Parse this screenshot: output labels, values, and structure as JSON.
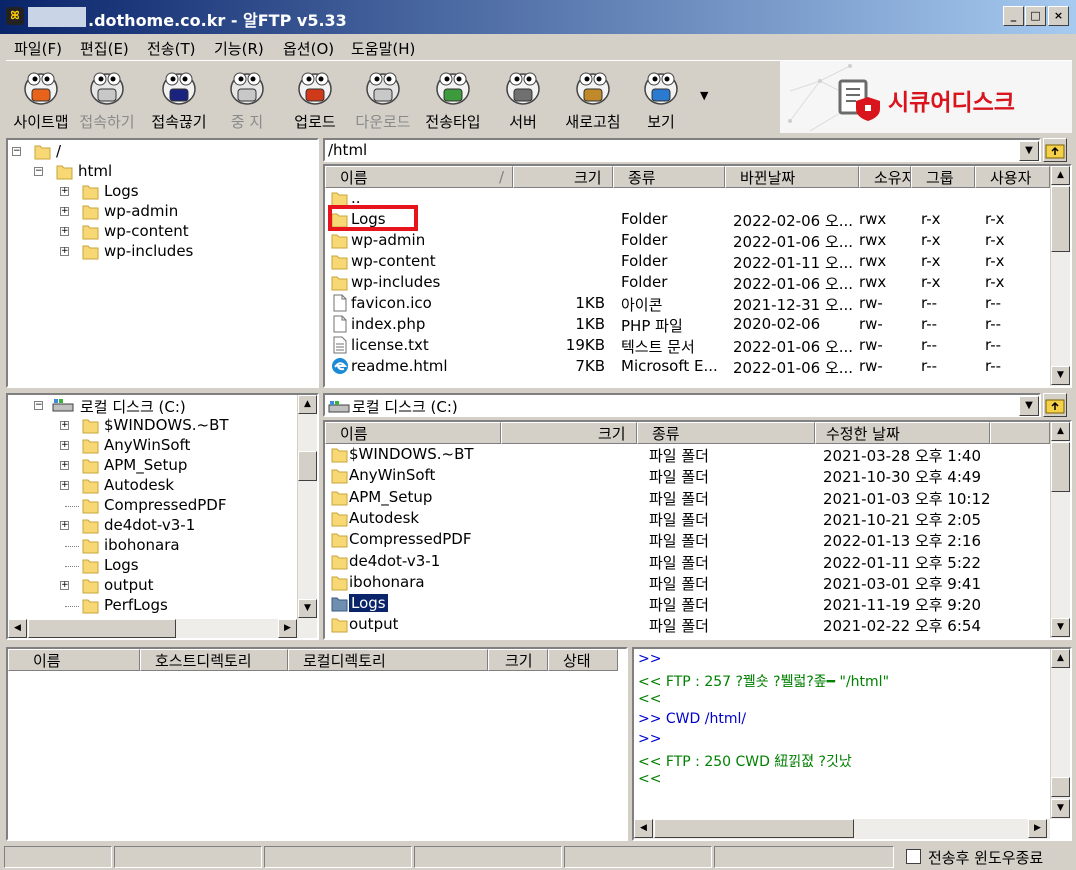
{
  "window": {
    "title": ".dothome.co.kr - 알FTP v5.33",
    "minimize_glyph": "_",
    "maximize_glyph": "□",
    "close_glyph": "×"
  },
  "menu": [
    "파일(F)",
    "편집(E)",
    "전송(T)",
    "기능(R)",
    "옵션(O)",
    "도움말(H)"
  ],
  "toolbar": [
    {
      "label": "사이트맵",
      "icon": "sitemap-icon",
      "enabled": true
    },
    {
      "label": "접속하기",
      "icon": "connect-icon",
      "enabled": false
    },
    {
      "label": "접속끊기",
      "icon": "disconnect-icon",
      "enabled": true
    },
    {
      "label": "중 지",
      "icon": "stop-icon",
      "enabled": false
    },
    {
      "label": "업로드",
      "icon": "upload-icon",
      "enabled": true
    },
    {
      "label": "다운로드",
      "icon": "download-icon",
      "enabled": false
    },
    {
      "label": "전송타입",
      "icon": "transfer-type-icon",
      "enabled": true
    },
    {
      "label": "서버",
      "icon": "server-icon",
      "enabled": true
    },
    {
      "label": "새로고침",
      "icon": "refresh-icon",
      "enabled": true
    },
    {
      "label": "보기",
      "icon": "view-icon",
      "enabled": true
    }
  ],
  "brand": {
    "text": "시큐어디스크",
    "color": "#d9141d"
  },
  "remote_tree": [
    {
      "label": "/",
      "level": 0,
      "expander": "−"
    },
    {
      "label": "html",
      "level": 1,
      "expander": "−"
    },
    {
      "label": "Logs",
      "level": 2,
      "expander": "+"
    },
    {
      "label": "wp-admin",
      "level": 2,
      "expander": "+"
    },
    {
      "label": "wp-content",
      "level": 2,
      "expander": "+"
    },
    {
      "label": "wp-includes",
      "level": 2,
      "expander": "+"
    }
  ],
  "remote_path": "/html",
  "remote_columns": [
    "이름",
    "크기",
    "종류",
    "바뀐날짜",
    "소유자",
    "그룹",
    "사용자"
  ],
  "remote_files": [
    {
      "name": "..",
      "size": "",
      "type": "",
      "date": "",
      "owner": "",
      "group": "",
      "other": "",
      "icon": "folder"
    },
    {
      "name": "Logs",
      "size": "",
      "type": "Folder",
      "date": "2022-02-06 오...",
      "owner": "rwx",
      "group": "r-x",
      "other": "r-x",
      "icon": "folder"
    },
    {
      "name": "wp-admin",
      "size": "",
      "type": "Folder",
      "date": "2022-01-06 오...",
      "owner": "rwx",
      "group": "r-x",
      "other": "r-x",
      "icon": "folder"
    },
    {
      "name": "wp-content",
      "size": "",
      "type": "Folder",
      "date": "2022-01-11 오...",
      "owner": "rwx",
      "group": "r-x",
      "other": "r-x",
      "icon": "folder"
    },
    {
      "name": "wp-includes",
      "size": "",
      "type": "Folder",
      "date": "2022-01-06 오...",
      "owner": "rwx",
      "group": "r-x",
      "other": "r-x",
      "icon": "folder"
    },
    {
      "name": "favicon.ico",
      "size": "1KB",
      "type": "아이콘",
      "date": "2021-12-31 오...",
      "owner": "rw-",
      "group": "r--",
      "other": "r--",
      "icon": "file"
    },
    {
      "name": "index.php",
      "size": "1KB",
      "type": "PHP 파일",
      "date": "2020-02-06",
      "owner": "rw-",
      "group": "r--",
      "other": "r--",
      "icon": "file"
    },
    {
      "name": "license.txt",
      "size": "19KB",
      "type": "텍스트 문서",
      "date": "2022-01-06 오...",
      "owner": "rw-",
      "group": "r--",
      "other": "r--",
      "icon": "text"
    },
    {
      "name": "readme.html",
      "size": "7KB",
      "type": "Microsoft E...",
      "date": "2022-01-06 오...",
      "owner": "rw-",
      "group": "r--",
      "other": "r--",
      "icon": "edge"
    }
  ],
  "local_tree": [
    {
      "label": "로컬 디스크 (C:)",
      "level": 0,
      "expander": "−"
    },
    {
      "label": "$WINDOWS.~BT",
      "level": 1,
      "expander": "+"
    },
    {
      "label": "AnyWinSoft",
      "level": 1,
      "expander": "+"
    },
    {
      "label": "APM_Setup",
      "level": 1,
      "expander": "+"
    },
    {
      "label": "Autodesk",
      "level": 1,
      "expander": "+"
    },
    {
      "label": "CompressedPDF",
      "level": 1,
      "expander": ""
    },
    {
      "label": "de4dot-v3-1",
      "level": 1,
      "expander": "+"
    },
    {
      "label": "ibohonara",
      "level": 1,
      "expander": ""
    },
    {
      "label": "Logs",
      "level": 1,
      "expander": ""
    },
    {
      "label": "output",
      "level": 1,
      "expander": "+"
    },
    {
      "label": "PerfLogs",
      "level": 1,
      "expander": ""
    }
  ],
  "local_path": "로컬 디스크 (C:)",
  "local_columns": [
    "이름",
    "크기",
    "종류",
    "수정한 날짜"
  ],
  "local_files": [
    {
      "name": "$WINDOWS.~BT",
      "type": "파일 폴더",
      "date": "2021-03-28 오후 1:40"
    },
    {
      "name": "AnyWinSoft",
      "type": "파일 폴더",
      "date": "2021-10-30 오후 4:49"
    },
    {
      "name": "APM_Setup",
      "type": "파일 폴더",
      "date": "2021-01-03 오후 10:12"
    },
    {
      "name": "Autodesk",
      "type": "파일 폴더",
      "date": "2021-10-21 오후 2:05"
    },
    {
      "name": "CompressedPDF",
      "type": "파일 폴더",
      "date": "2022-01-13 오후 2:16"
    },
    {
      "name": "de4dot-v3-1",
      "type": "파일 폴더",
      "date": "2022-01-11 오후 5:22"
    },
    {
      "name": "ibohonara",
      "type": "파일 폴더",
      "date": "2021-03-01 오후 9:41"
    },
    {
      "name": "Logs",
      "type": "파일 폴더",
      "date": "2021-11-19 오후 9:20",
      "selected": true
    },
    {
      "name": "output",
      "type": "파일 폴더",
      "date": "2021-02-22 오후 6:54"
    }
  ],
  "queue_columns": [
    "이름",
    "호스트디렉토리",
    "로컬디렉토리",
    "크기",
    "상태"
  ],
  "log": [
    {
      "text": ">>",
      "color": "#0000cc"
    },
    {
      "text": "<< FTP : 257 ?꿸숏 ?뷀럷?좊━ \"/html\"",
      "color": "#008000"
    },
    {
      "text": "<<",
      "color": "#008000"
    },
    {
      "text": ">> CWD /html/",
      "color": "#0000cc"
    },
    {
      "text": ">>",
      "color": "#0000cc"
    },
    {
      "text": "<< FTP : 250 CWD 紐낅졊 ?깃났",
      "color": "#008000"
    },
    {
      "text": "<<",
      "color": "#008000"
    }
  ],
  "status": {
    "close_after_transfer_label": "전송후 윈도우종료",
    "close_after_transfer_checked": false
  },
  "highlight_color": "#e8141b"
}
